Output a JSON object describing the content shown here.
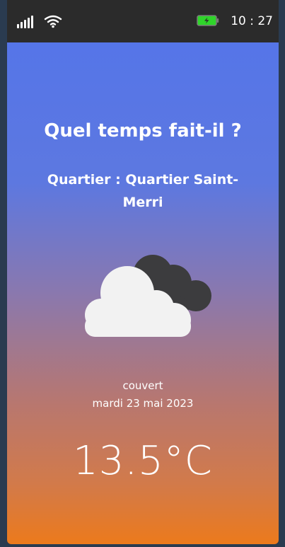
{
  "status_bar": {
    "time": "10 : 27",
    "signal_icon": "cellular-signal-icon",
    "wifi_icon": "wifi-icon",
    "battery_icon": "battery-charging-icon",
    "battery_color": "#2fd52a"
  },
  "weather": {
    "title": "Quel temps fait-il ?",
    "district": "Quartier : Quartier Saint-Merri",
    "icon": "cloudy-icon",
    "condition": "couvert",
    "date": "mardi 23 mai 2023",
    "temperature": "13.5°C"
  },
  "colors": {
    "gradient_top": "#5575e8",
    "gradient_bottom": "#ec7a1c",
    "status_bar_bg": "#2b2b2b",
    "front_cloud": "#f2f2f2",
    "back_cloud": "#3c3c3e"
  }
}
